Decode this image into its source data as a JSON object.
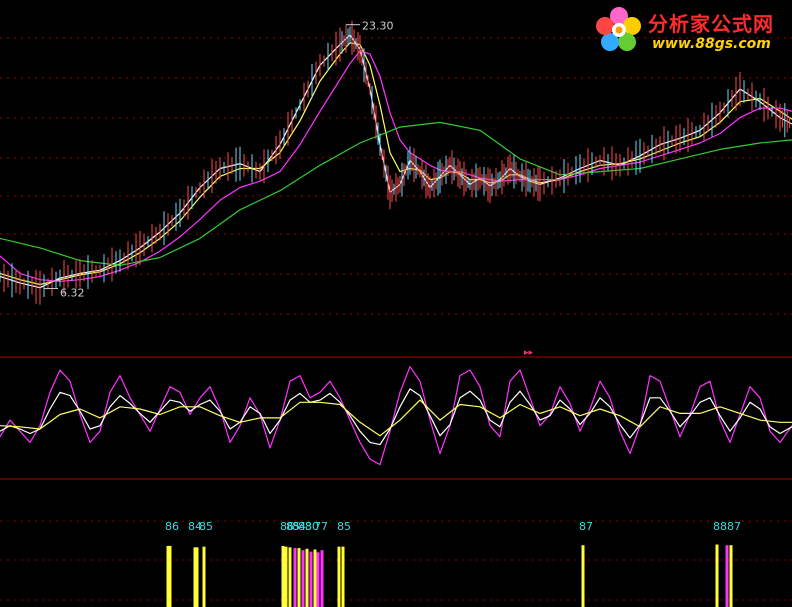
{
  "chart_data": [
    {
      "type": "line",
      "panel": "price",
      "series": [
        {
          "color": "#ffffff",
          "x": [
            0,
            20,
            40,
            60,
            80,
            100,
            120,
            140,
            160,
            180,
            200,
            220,
            240,
            260,
            280,
            300,
            320,
            340,
            350,
            360,
            370,
            380,
            390,
            400,
            410,
            420,
            430,
            440,
            450,
            460,
            470,
            480,
            490,
            500,
            510,
            520,
            530,
            540,
            560,
            580,
            600,
            620,
            640,
            660,
            680,
            700,
            720,
            740,
            760,
            780,
            792
          ],
          "y": [
            7.2,
            6.8,
            6.5,
            7.1,
            7.4,
            7.6,
            8.2,
            9.0,
            10.0,
            11.2,
            12.8,
            14.0,
            14.3,
            13.8,
            15.5,
            18.0,
            20.5,
            21.8,
            22.4,
            21.5,
            19.0,
            15.5,
            12.5,
            13.0,
            14.5,
            13.8,
            12.8,
            13.5,
            14.2,
            13.6,
            13.0,
            13.4,
            12.9,
            13.3,
            14.0,
            13.5,
            13.2,
            13.0,
            13.4,
            14.0,
            14.5,
            14.2,
            14.8,
            15.5,
            15.9,
            16.4,
            17.5,
            19.0,
            18.2,
            17.2,
            16.8
          ]
        },
        {
          "color": "#ffff66",
          "x": [
            0,
            20,
            40,
            60,
            80,
            100,
            120,
            140,
            160,
            180,
            200,
            220,
            240,
            260,
            280,
            300,
            320,
            340,
            350,
            360,
            370,
            380,
            390,
            400,
            410,
            420,
            430,
            440,
            450,
            460,
            470,
            480,
            490,
            500,
            510,
            520,
            530,
            540,
            560,
            580,
            600,
            620,
            640,
            660,
            680,
            700,
            720,
            740,
            760,
            780,
            792
          ],
          "y": [
            7.4,
            7.0,
            6.7,
            7.0,
            7.3,
            7.5,
            8.0,
            8.7,
            9.6,
            10.7,
            12.2,
            13.5,
            14.0,
            14.0,
            15.0,
            17.0,
            19.5,
            21.2,
            21.9,
            21.8,
            20.5,
            18.0,
            15.0,
            13.8,
            14.0,
            13.9,
            13.3,
            13.4,
            13.8,
            13.7,
            13.3,
            13.3,
            13.1,
            13.2,
            13.6,
            13.6,
            13.3,
            13.1,
            13.3,
            13.8,
            14.2,
            14.3,
            14.6,
            15.1,
            15.6,
            16.0,
            16.9,
            18.2,
            18.4,
            17.6,
            17.1
          ]
        },
        {
          "color": "#ff33ff",
          "x": [
            0,
            20,
            40,
            60,
            80,
            100,
            120,
            140,
            160,
            180,
            200,
            220,
            240,
            260,
            280,
            300,
            320,
            340,
            350,
            360,
            370,
            380,
            390,
            400,
            410,
            420,
            430,
            440,
            450,
            460,
            470,
            480,
            490,
            500,
            520,
            540,
            560,
            580,
            600,
            620,
            640,
            660,
            680,
            700,
            720,
            740,
            760,
            780,
            792
          ],
          "y": [
            8.5,
            7.4,
            7.0,
            6.9,
            7.0,
            7.2,
            7.6,
            8.1,
            8.8,
            9.7,
            10.8,
            12.0,
            12.8,
            13.2,
            13.8,
            15.5,
            17.6,
            19.6,
            20.6,
            21.4,
            21.2,
            19.8,
            17.5,
            15.8,
            15.0,
            14.6,
            14.2,
            13.9,
            13.8,
            13.8,
            13.6,
            13.4,
            13.3,
            13.2,
            13.3,
            13.3,
            13.3,
            13.6,
            14.0,
            14.2,
            14.4,
            14.8,
            15.2,
            15.6,
            16.2,
            17.2,
            17.8,
            17.8,
            17.6
          ]
        },
        {
          "color": "#33cc33",
          "x": [
            0,
            40,
            80,
            120,
            160,
            200,
            240,
            280,
            320,
            360,
            400,
            440,
            480,
            520,
            560,
            600,
            640,
            680,
            720,
            760,
            792
          ],
          "y": [
            9.6,
            9.0,
            8.2,
            7.9,
            8.4,
            9.6,
            11.4,
            12.6,
            14.2,
            15.6,
            16.6,
            16.9,
            16.4,
            14.6,
            13.6,
            13.8,
            14.0,
            14.6,
            15.2,
            15.6,
            15.8
          ]
        }
      ],
      "annotations": [
        {
          "text": "23.30",
          "x": 346,
          "y": 23.3
        },
        {
          "text": "6.32",
          "x": 44,
          "y": 6.32
        }
      ],
      "ylim": [
        2.2,
        24.6
      ],
      "xlim": [
        0,
        792
      ]
    },
    {
      "type": "line",
      "panel": "oscillator",
      "series": [
        {
          "color": "#ff33ff",
          "x": [
            0,
            10,
            20,
            30,
            40,
            50,
            60,
            70,
            80,
            90,
            100,
            110,
            120,
            130,
            140,
            150,
            160,
            170,
            180,
            190,
            200,
            210,
            220,
            230,
            240,
            250,
            260,
            270,
            280,
            290,
            300,
            310,
            320,
            330,
            340,
            350,
            360,
            370,
            380,
            390,
            400,
            410,
            420,
            430,
            440,
            450,
            460,
            470,
            480,
            490,
            500,
            510,
            520,
            530,
            540,
            550,
            560,
            570,
            580,
            590,
            600,
            610,
            620,
            630,
            640,
            650,
            660,
            670,
            680,
            690,
            700,
            710,
            720,
            730,
            740,
            750,
            760,
            770,
            780,
            792
          ],
          "y": [
            35,
            50,
            40,
            30,
            45,
            75,
            95,
            85,
            55,
            30,
            40,
            75,
            90,
            70,
            55,
            40,
            60,
            80,
            75,
            55,
            70,
            80,
            60,
            30,
            45,
            70,
            55,
            25,
            50,
            85,
            90,
            70,
            75,
            85,
            70,
            50,
            30,
            15,
            10,
            40,
            75,
            98,
            85,
            50,
            20,
            45,
            90,
            95,
            80,
            45,
            35,
            85,
            95,
            70,
            45,
            55,
            80,
            65,
            40,
            60,
            85,
            70,
            40,
            20,
            45,
            90,
            85,
            60,
            35,
            55,
            80,
            85,
            50,
            30,
            55,
            80,
            70,
            40,
            30,
            45
          ]
        },
        {
          "color": "#ffffff",
          "x": [
            0,
            10,
            20,
            30,
            40,
            50,
            60,
            70,
            80,
            90,
            100,
            110,
            120,
            130,
            140,
            150,
            160,
            170,
            180,
            190,
            200,
            210,
            220,
            230,
            240,
            250,
            260,
            270,
            280,
            290,
            300,
            310,
            320,
            330,
            340,
            350,
            360,
            370,
            380,
            390,
            400,
            410,
            420,
            430,
            440,
            450,
            460,
            470,
            480,
            490,
            500,
            510,
            520,
            530,
            540,
            550,
            560,
            570,
            580,
            590,
            600,
            610,
            620,
            630,
            640,
            650,
            660,
            670,
            680,
            690,
            700,
            710,
            720,
            730,
            740,
            750,
            760,
            770,
            780,
            792
          ],
          "y": [
            40,
            45,
            42,
            38,
            42,
            60,
            75,
            72,
            58,
            42,
            45,
            62,
            72,
            65,
            56,
            48,
            58,
            68,
            66,
            58,
            64,
            68,
            58,
            42,
            48,
            62,
            56,
            38,
            50,
            68,
            74,
            66,
            68,
            74,
            66,
            54,
            40,
            30,
            28,
            42,
            62,
            78,
            72,
            54,
            36,
            46,
            70,
            76,
            68,
            50,
            44,
            66,
            76,
            64,
            50,
            54,
            68,
            60,
            46,
            56,
            70,
            62,
            46,
            34,
            46,
            70,
            70,
            58,
            44,
            54,
            66,
            70,
            54,
            40,
            52,
            66,
            60,
            44,
            38,
            44
          ]
        },
        {
          "color": "#ffff66",
          "x": [
            0,
            20,
            40,
            60,
            80,
            100,
            120,
            140,
            160,
            180,
            200,
            220,
            240,
            260,
            280,
            300,
            320,
            340,
            360,
            380,
            400,
            420,
            440,
            460,
            480,
            500,
            520,
            540,
            560,
            580,
            600,
            620,
            640,
            660,
            680,
            700,
            720,
            740,
            760,
            780,
            792
          ],
          "y": [
            45,
            44,
            42,
            55,
            60,
            52,
            62,
            60,
            55,
            62,
            62,
            54,
            48,
            52,
            52,
            66,
            66,
            64,
            48,
            36,
            50,
            68,
            50,
            64,
            62,
            52,
            64,
            56,
            62,
            54,
            60,
            54,
            44,
            62,
            56,
            56,
            62,
            56,
            50,
            48,
            48
          ]
        }
      ],
      "ylim": [
        -2,
        104
      ],
      "xlim": [
        0,
        792
      ]
    },
    {
      "type": "bar",
      "panel": "signals",
      "bars": [
        {
          "x": 168,
          "color": "#ffff33",
          "value": 86
        },
        {
          "x": 170,
          "color": "#ffff33",
          "value": 86
        },
        {
          "x": 195,
          "color": "#ffff33",
          "value": 84
        },
        {
          "x": 197,
          "color": "#ffff33",
          "value": 84
        },
        {
          "x": 204,
          "color": "#ffff33",
          "value": 85
        },
        {
          "x": 283,
          "color": "#ffff33",
          "value": 86
        },
        {
          "x": 286,
          "color": "#ffff33",
          "value": 85
        },
        {
          "x": 290,
          "color": "#ffff33",
          "value": 84
        },
        {
          "x": 295,
          "color": "#ff33ff",
          "value": 83
        },
        {
          "x": 299,
          "color": "#ffff33",
          "value": 83
        },
        {
          "x": 303,
          "color": "#ff33ff",
          "value": 80
        },
        {
          "x": 307,
          "color": "#ffff33",
          "value": 82
        },
        {
          "x": 311,
          "color": "#ff33ff",
          "value": 78
        },
        {
          "x": 315,
          "color": "#ffff33",
          "value": 81
        },
        {
          "x": 318,
          "color": "#ff33ff",
          "value": 77
        },
        {
          "x": 322,
          "color": "#ff33ff",
          "value": 80
        },
        {
          "x": 339,
          "color": "#ffff33",
          "value": 85
        },
        {
          "x": 343,
          "color": "#ffff33",
          "value": 85
        },
        {
          "x": 583,
          "color": "#ffff33",
          "value": 87
        },
        {
          "x": 717,
          "color": "#ffff33",
          "value": 88
        },
        {
          "x": 727,
          "color": "#ff33ff",
          "value": 87
        },
        {
          "x": 731,
          "color": "#ffff33",
          "value": 87
        }
      ],
      "labels": [
        {
          "text": "86",
          "x": 171
        },
        {
          "text": "84",
          "x": 194
        },
        {
          "text": "85",
          "x": 205
        },
        {
          "text": "86",
          "x": 286
        },
        {
          "text": "85",
          "x": 292
        },
        {
          "text": "84",
          "x": 298
        },
        {
          "text": "83",
          "x": 304
        },
        {
          "text": "80",
          "x": 311
        },
        {
          "text": "77",
          "x": 320
        },
        {
          "text": "85",
          "x": 343
        },
        {
          "text": "87",
          "x": 585
        },
        {
          "text": "88",
          "x": 719
        },
        {
          "text": "87",
          "x": 733
        }
      ],
      "ylim": [
        0,
        100
      ],
      "xlim": [
        0,
        792
      ]
    }
  ],
  "logo": {
    "title": "分析家公式网",
    "url": "www.88gs.com"
  },
  "colors": {
    "background": "#000000",
    "divider": "#b00000",
    "grid": "#b00000",
    "bar_label": "#33dddd",
    "annotation": "#cccccc"
  }
}
